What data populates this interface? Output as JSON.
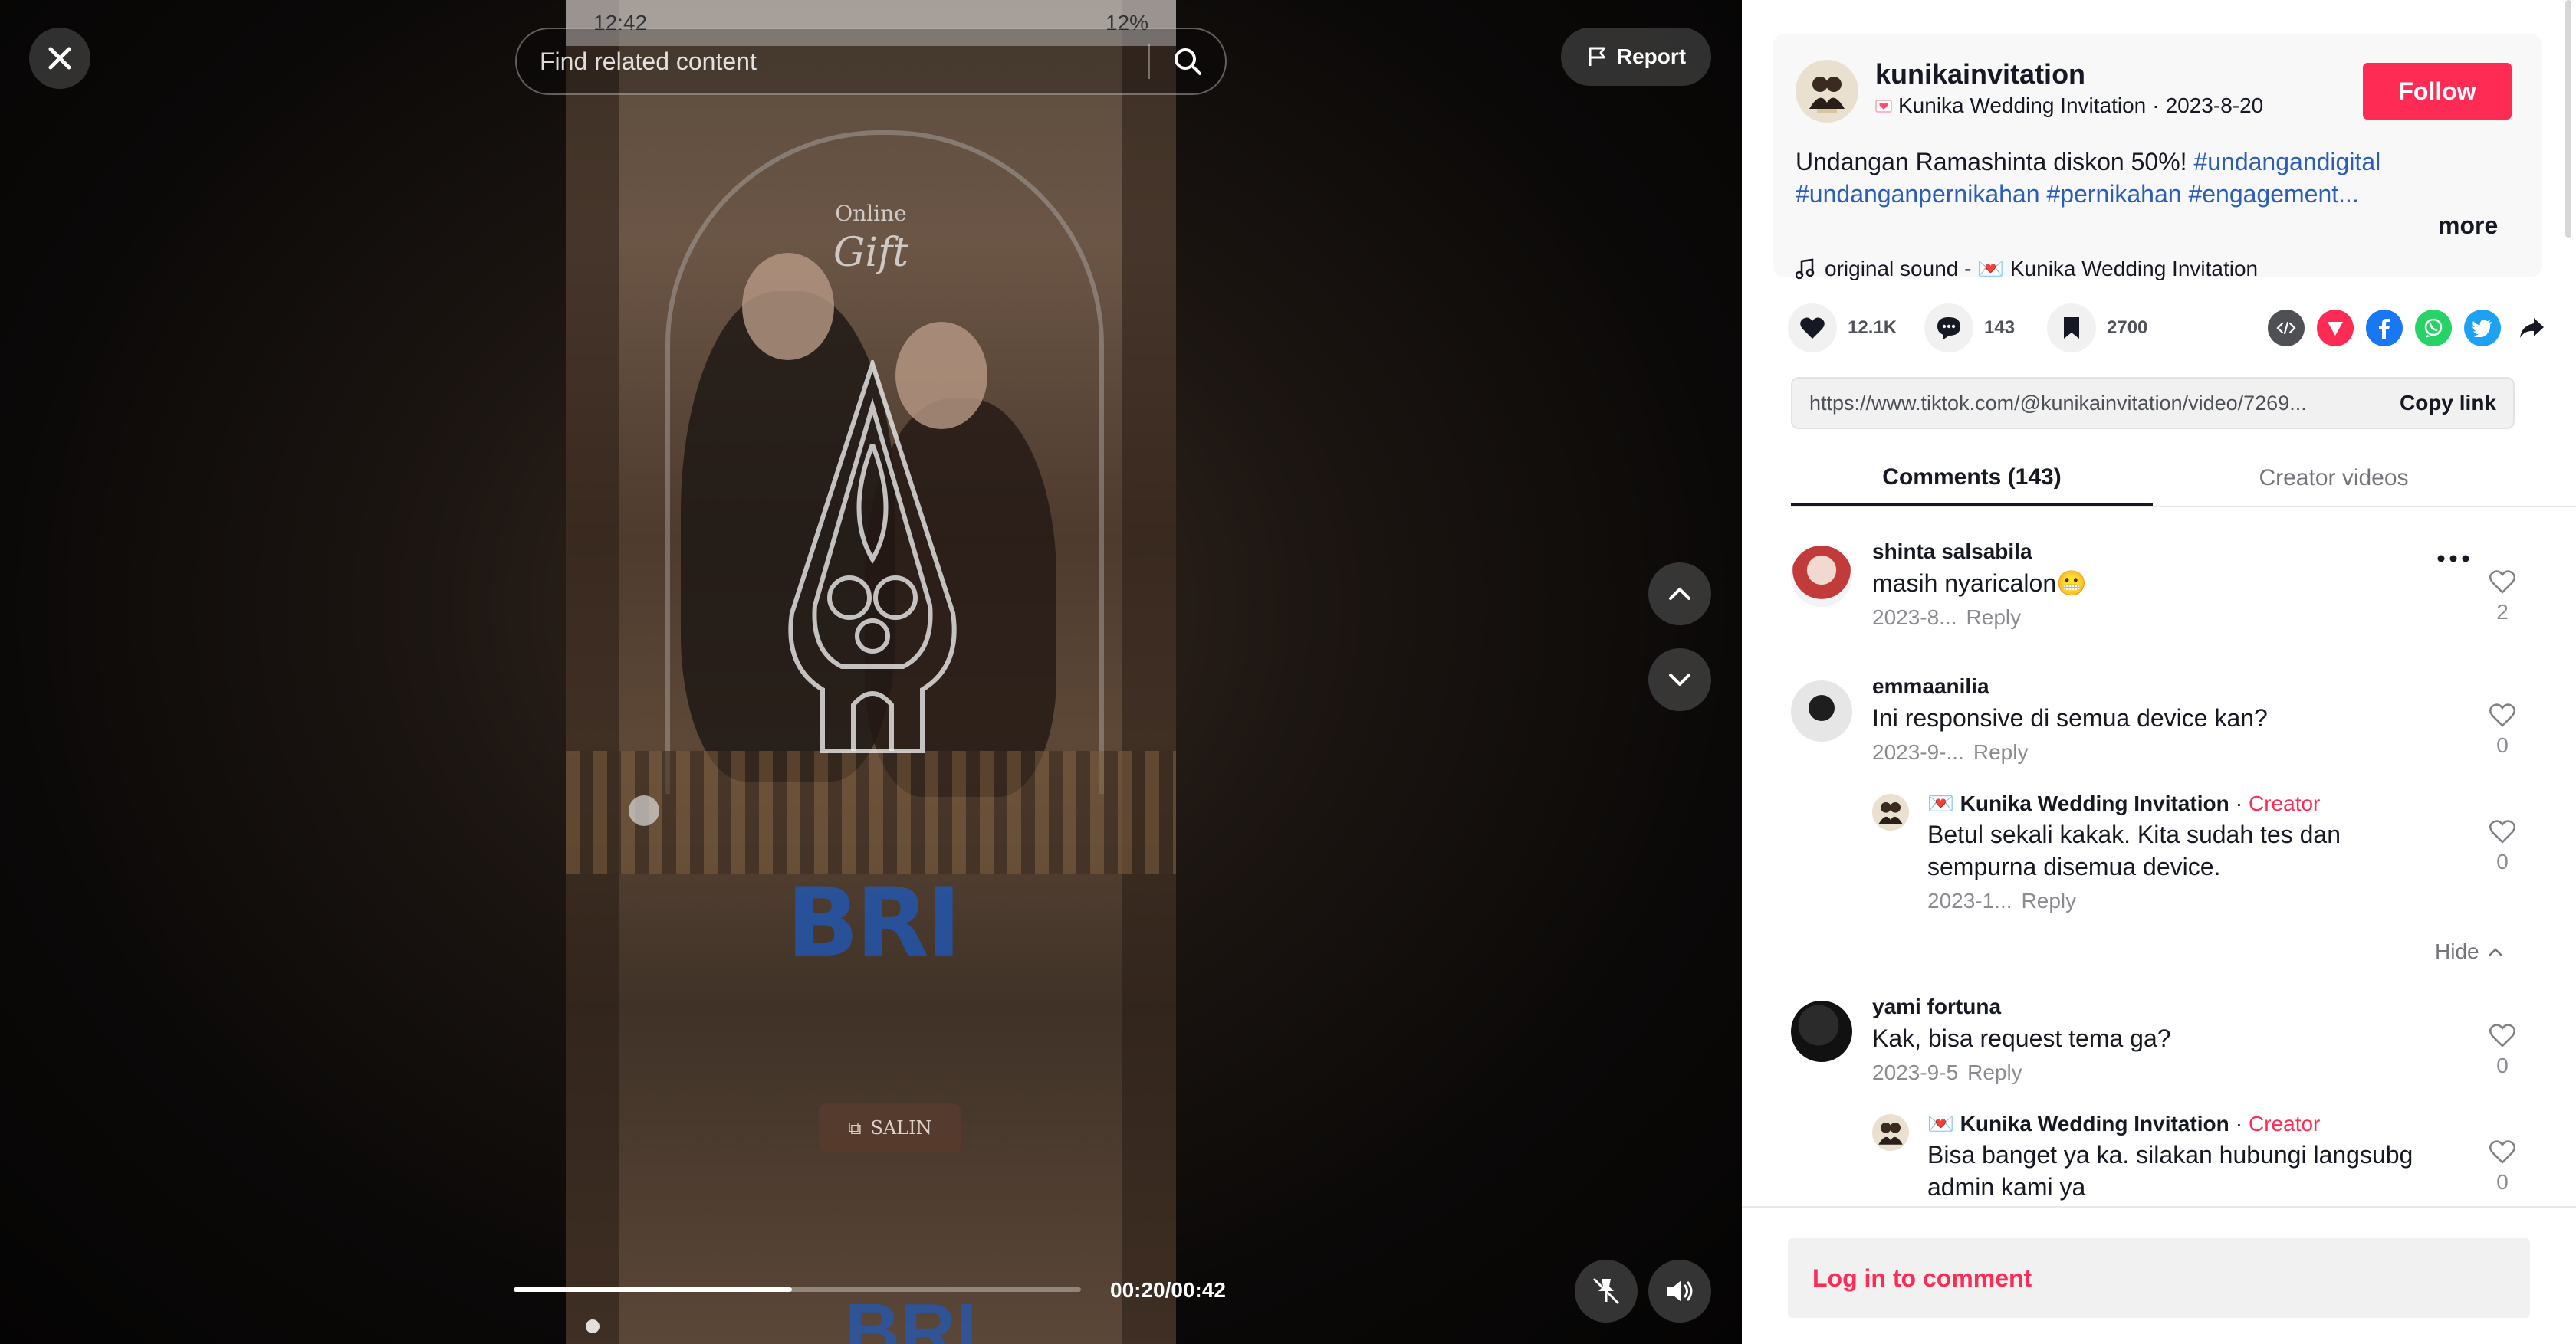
{
  "video": {
    "search_placeholder": "Find related content",
    "report_label": "Report",
    "time": "00:20/00:42",
    "progress": 0.49,
    "frame": {
      "status_time": "12:42",
      "status_battery": "12%",
      "gift_top": "Online",
      "gift_script": "Gift",
      "bank_logo": "BRI",
      "copy_label": "SALIN"
    }
  },
  "author": {
    "username": "kunikainvitation",
    "display_name": "Kunika Wedding Invitation",
    "date": "2023-8-20",
    "follow_label": "Follow"
  },
  "description": {
    "text": "Undangan Ramashinta diskon 50%!",
    "tags_line1": [
      "#undangandigital"
    ],
    "tags_line2": [
      "#undanganpernikahan",
      "#pernikahan",
      "#engagement..."
    ],
    "more_label": "more"
  },
  "sound": "original sound - 💌 Kunika Wedding Invitation",
  "actions": {
    "likes": "12.1K",
    "comments": "143",
    "saves": "2700"
  },
  "share_icons": [
    "embed-icon",
    "send-icon",
    "facebook-icon",
    "whatsapp-icon",
    "twitter-icon",
    "share-arrow-icon"
  ],
  "link": {
    "url": "https://www.tiktok.com/@kunikainvitation/video/7269...",
    "copy_label": "Copy link"
  },
  "tabs": [
    "Comments (143)",
    "Creator videos"
  ],
  "comments": [
    {
      "user": "shinta salsabila",
      "text": "masih nyaricalon😬",
      "date": "2023-8...",
      "reply": "Reply",
      "likes": "2"
    },
    {
      "user": "emmaanilia",
      "text": "Ini responsive di semua device kan?",
      "date": "2023-9-...",
      "reply": "Reply",
      "likes": "0"
    },
    {
      "user": "💌 Kunika Wedding Invitation",
      "creator": "Creator",
      "text": "Betul sekali kakak. Kita sudah tes dan sempurna disemua device.",
      "date": "2023-1...",
      "reply": "Reply",
      "likes": "0"
    },
    {
      "user": "yami fortuna",
      "text": "Kak, bisa request tema ga?",
      "date": "2023-9-5",
      "reply": "Reply",
      "likes": "0"
    },
    {
      "user": "💌 Kunika Wedding Invitation",
      "creator": "Creator",
      "text": "Bisa banget ya ka. silakan hubungi langsubg admin kami ya",
      "date": "",
      "reply": "",
      "likes": "0"
    }
  ],
  "hide_label": "Hide",
  "creator_separator": "·",
  "login_prompt": "Log in to comment",
  "colors": {
    "accent": "#fe2c55",
    "hashtag": "#2b5db9"
  }
}
